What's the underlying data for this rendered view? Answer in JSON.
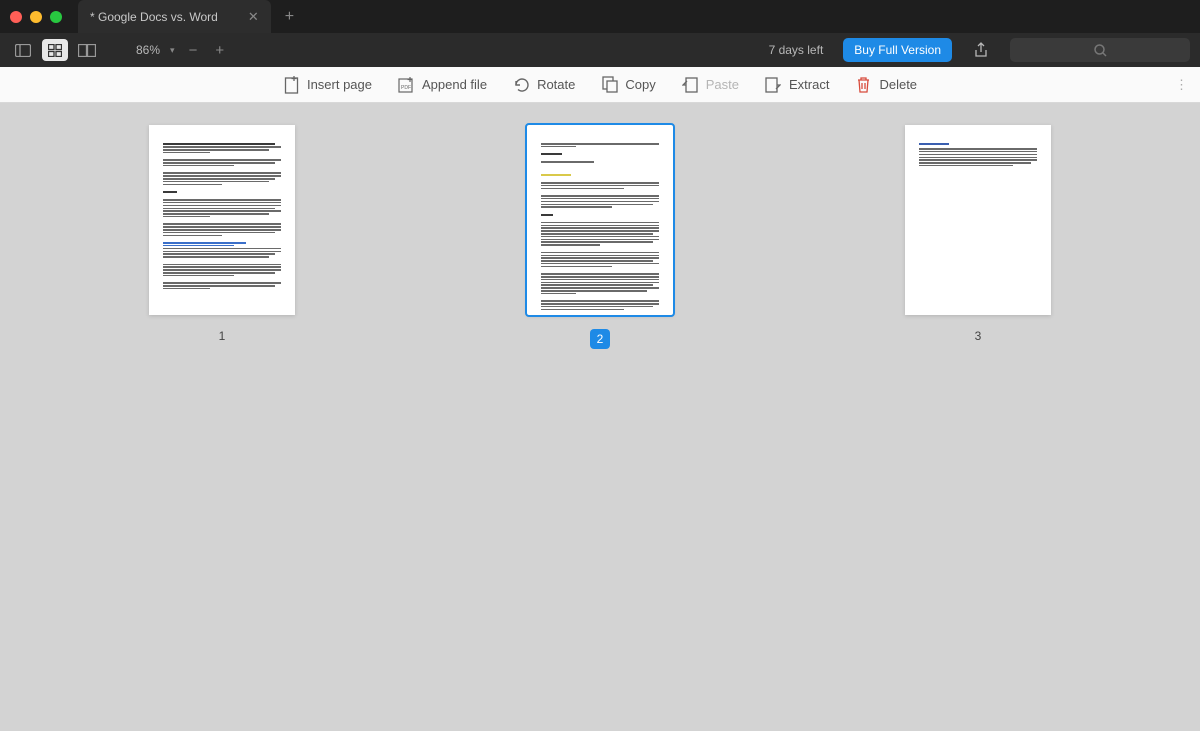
{
  "window": {
    "tab_title": "* Google Docs vs. Word"
  },
  "toolbar": {
    "zoom_level": "86%",
    "trial_text": "7 days left",
    "buy_label": "Buy Full Version"
  },
  "actions": {
    "insert_page": "Insert page",
    "append_file": "Append file",
    "rotate": "Rotate",
    "copy": "Copy",
    "paste": "Paste",
    "extract": "Extract",
    "delete": "Delete"
  },
  "pages": [
    {
      "number": "1",
      "selected": false
    },
    {
      "number": "2",
      "selected": true
    },
    {
      "number": "3",
      "selected": false
    }
  ],
  "colors": {
    "accent": "#1e8ae6",
    "danger": "#d84b3c"
  }
}
